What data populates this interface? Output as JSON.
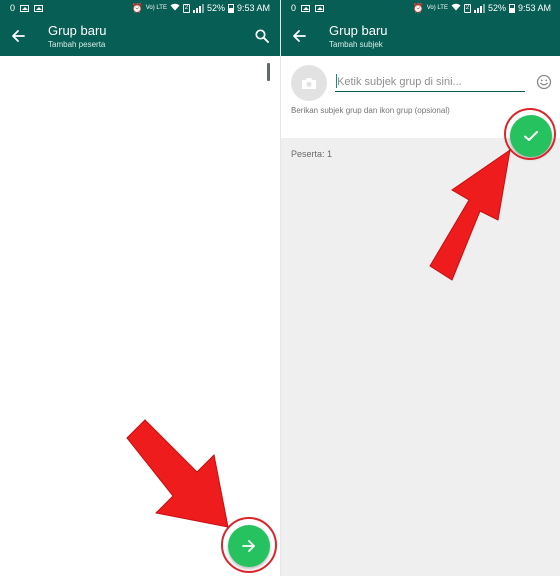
{
  "status_bar": {
    "left_digit": "0",
    "battery": "52%",
    "time": "9:53 AM",
    "sim_label": "2",
    "volte_label": "Vo) LTE"
  },
  "left_screen": {
    "toolbar": {
      "title": "Grup baru",
      "subtitle": "Tambah peserta",
      "back_icon": "arrow-left-icon",
      "search_icon": "search-icon"
    },
    "fab": {
      "icon": "arrow-right-icon"
    }
  },
  "right_screen": {
    "toolbar": {
      "title": "Grup baru",
      "subtitle": "Tambah subjek",
      "back_icon": "arrow-left-icon"
    },
    "subject": {
      "value": "",
      "placeholder": "Ketik subjek grup di sini..."
    },
    "helper_text": "Berikan subjek grup dan ikon grup (opsional)",
    "participants_label": "Peserta: 1",
    "fab": {
      "icon": "check-icon"
    }
  },
  "colors": {
    "toolbar": "#075e54",
    "fab": "#25c25f",
    "highlight": "#d9262b",
    "arrow": "#ee1c1c"
  }
}
